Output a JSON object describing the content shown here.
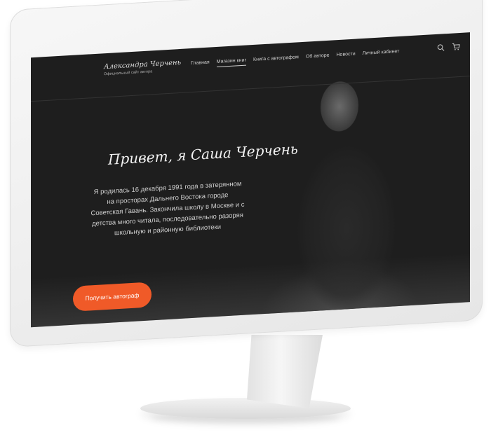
{
  "site": {
    "logo_title": "Александра Черчень",
    "logo_subtitle": "Официальный сайт автора"
  },
  "nav": {
    "items": [
      {
        "label": "Главная",
        "active": false
      },
      {
        "label": "Магазин книг",
        "active": true
      },
      {
        "label": "Книга с автографом",
        "active": false
      },
      {
        "label": "Об авторе",
        "active": false
      },
      {
        "label": "Новости",
        "active": false
      },
      {
        "label": "Личный кабинет",
        "active": false
      }
    ],
    "icons": [
      "search-icon",
      "cart-icon"
    ]
  },
  "hero": {
    "title": "Привет, я Саша Черчень",
    "text": "Я родилась 16 декабря 1991 года в затерянном на просторах Дальнего Востока городе Советская Гавань. Закончила школу в Москве и с детства много читала, последовательно разоряя школьную и районную библиотеки",
    "cta_label": "Получить автограф"
  },
  "colors": {
    "accent": "#f05a28",
    "screen_bg": "#1e1e1e",
    "monitor_bezel": "#f0f0f0"
  }
}
